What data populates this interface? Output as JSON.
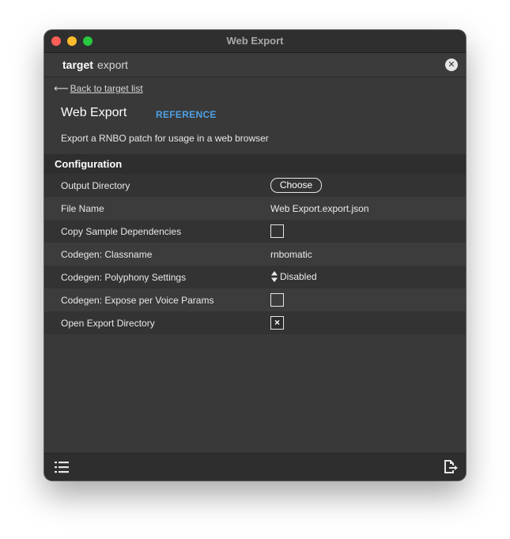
{
  "window": {
    "title": "Web Export"
  },
  "tabbar": {
    "target_label": "target",
    "export_label": "export"
  },
  "nav": {
    "back_label": "Back to target list"
  },
  "header": {
    "title": "Web Export",
    "reference_label": "REFERENCE",
    "description": "Export a RNBO patch for usage in a web browser"
  },
  "section": {
    "title": "Configuration"
  },
  "config": {
    "output_directory": {
      "label": "Output Directory",
      "button_label": "Choose"
    },
    "file_name": {
      "label": "File Name",
      "value": "Web Export.export.json"
    },
    "copy_sample_dependencies": {
      "label": "Copy Sample Dependencies",
      "checked": false
    },
    "codegen_classname": {
      "label": "Codegen: Classname",
      "value": "rnbomatic"
    },
    "codegen_polyphony": {
      "label": "Codegen: Polyphony Settings",
      "value": "Disabled"
    },
    "codegen_expose_voice_params": {
      "label": "Codegen: Expose per Voice Params",
      "checked": false
    },
    "open_export_directory": {
      "label": "Open Export Directory",
      "checked": true,
      "mark": "×"
    }
  },
  "icons": {
    "close": "close-icon",
    "back": "arrow-left-icon",
    "stepper": "up-down-stepper-icon",
    "list": "list-icon",
    "export": "export-document-icon"
  },
  "colors": {
    "accent": "#4ea1e6",
    "window_bg": "#393939",
    "titlebar_bg": "#2f2f2f"
  }
}
